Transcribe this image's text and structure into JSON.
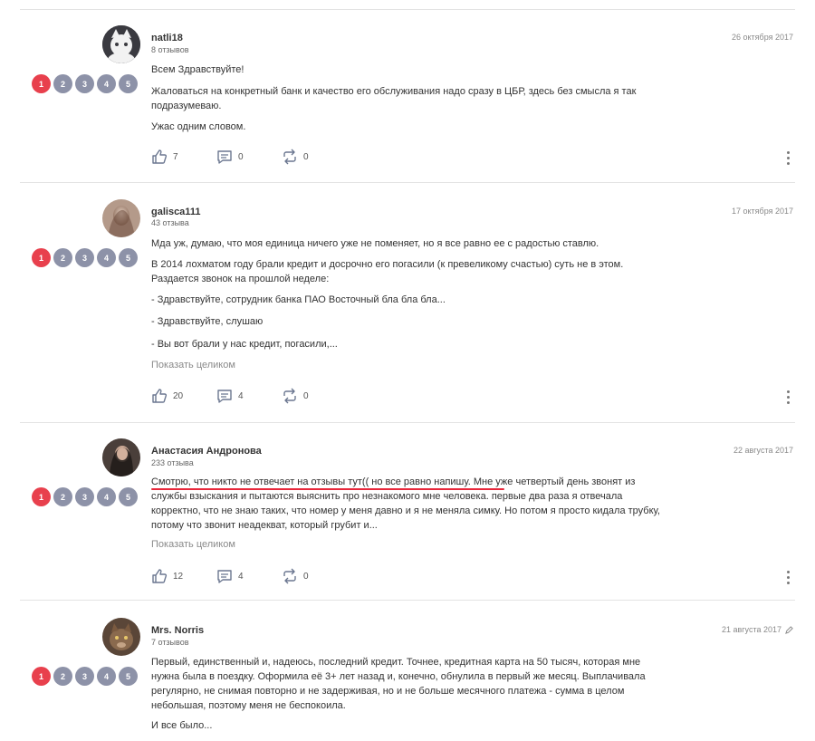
{
  "rating_labels": [
    "1",
    "2",
    "3",
    "4",
    "5"
  ],
  "more_label": "Показать целиком",
  "reviews": [
    {
      "author": "natli18",
      "reviews_count": "8 отзывов",
      "date": "26 октября 2017",
      "rating": 1,
      "paragraphs": [
        "Всем Здравствуйте!",
        "Жаловаться на конкретный банк и качество его обслуживания надо сразу в ЦБР, здесь без смысла я так подразумеваю.",
        "Ужас одним словом."
      ],
      "likes": "7",
      "comments": "0",
      "reposts": "0"
    },
    {
      "author": "galisca111",
      "reviews_count": "43 отзыва",
      "date": "17 октября 2017",
      "rating": 1,
      "paragraphs": [
        "Мда уж, думаю, что моя единица ничего уже не поменяет, но я все равно ее с радостью ставлю.",
        "В 2014 лохматом году брали кредит и досрочно его погасили (к превеликому счастью) суть не в этом. Раздается звонок на прошлой неделе:",
        "- Здравствуйте, сотрудник банка ПАО Восточный бла бла бла...",
        "- Здравствуйте, слушаю",
        "- Вы вот брали у нас кредит, погасили,..."
      ],
      "likes": "20",
      "comments": "4",
      "reposts": "0"
    },
    {
      "author": "Анастасия Андронова",
      "reviews_count": "233 отзыва",
      "date": "22 августа 2017",
      "rating": 1,
      "paragraphs": [
        "Смотрю, что никто не отвечает на отзывы тут(( но все равно напишу. Мне уже четвертый день звонят из службы взыскания и пытаются выяснить про незнакомого мне человека. первые два раза я отвечала корректно, что не знаю таких, что номер у меня давно и я не меняла симку. Но потом я просто кидала трубку, потому что звонит неадекват, который грубит и..."
      ],
      "likes": "12",
      "comments": "4",
      "reposts": "0"
    },
    {
      "author": "Mrs. Norris",
      "reviews_count": "7 отзывов",
      "date": "21 августа 2017",
      "rating": 1,
      "paragraphs": [
        "Первый, единственный и, надеюсь, последний кредит. Точнее, кредитная карта на 50 тысяч, которая мне нужна была в поездку. Оформила её 3+ лет назад и, конечно, обнулила в первый же месяц. Выплачивала регулярно, не снимая повторно и не задерживая, но и не больше месячного платежа - сумма в целом небольшая, поэтому меня не беспокоила.",
        "И все было..."
      ]
    }
  ]
}
